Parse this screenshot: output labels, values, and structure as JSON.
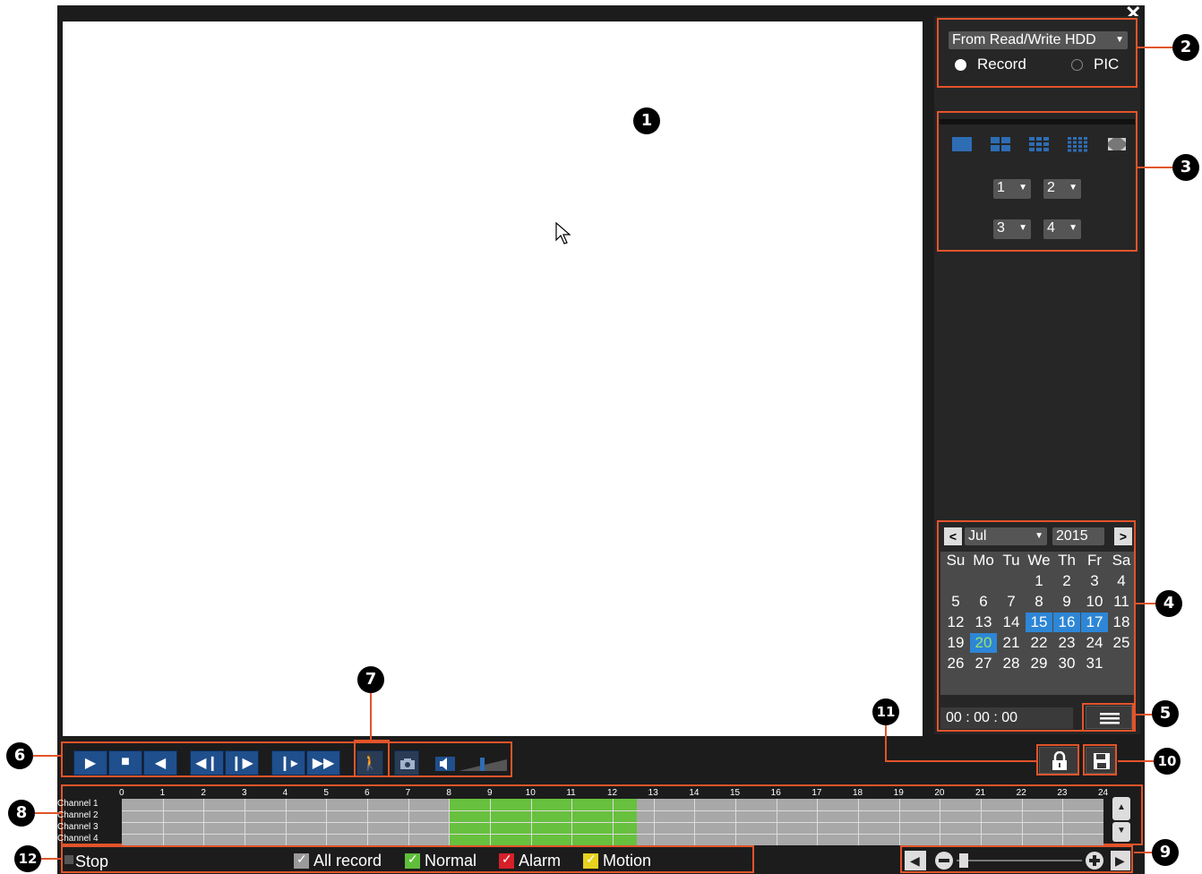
{
  "source": {
    "selected": "From Read/Write HDD",
    "options": [
      "Record",
      "PIC"
    ],
    "active": "Record"
  },
  "callouts": [
    "1",
    "2",
    "3",
    "4",
    "5",
    "6",
    "7",
    "8",
    "9",
    "10",
    "11",
    "12"
  ],
  "layout_icons": [
    "single-view-icon",
    "quad-view-icon",
    "nine-view-icon",
    "sixteen-view-icon",
    "fullscreen-icon"
  ],
  "channel_selects": [
    "1",
    "2",
    "3",
    "4"
  ],
  "calendar": {
    "month": "Jul",
    "year": "2015",
    "prev": "<",
    "next": ">",
    "weekdays": [
      "Su",
      "Mo",
      "Tu",
      "We",
      "Th",
      "Fr",
      "Sa"
    ],
    "days": [
      [
        "",
        "",
        "",
        "1",
        "2",
        "3",
        "4"
      ],
      [
        "5",
        "6",
        "7",
        "8",
        "9",
        "10",
        "11"
      ],
      [
        "12",
        "13",
        "14",
        "15",
        "16",
        "17",
        "18"
      ],
      [
        "19",
        "20",
        "21",
        "22",
        "23",
        "24",
        "25"
      ],
      [
        "26",
        "27",
        "28",
        "29",
        "30",
        "31",
        ""
      ]
    ],
    "highlighted": [
      "15",
      "16",
      "17"
    ],
    "today": "20"
  },
  "time": "00 : 00 : 00",
  "timeline": {
    "hours": [
      "0",
      "1",
      "2",
      "3",
      "4",
      "5",
      "6",
      "7",
      "8",
      "9",
      "10",
      "11",
      "12",
      "13",
      "14",
      "15",
      "16",
      "17",
      "18",
      "19",
      "20",
      "21",
      "22",
      "23",
      "24"
    ],
    "channels": [
      "Channel 1",
      "Channel 2",
      "Channel 3",
      "Channel 4"
    ],
    "recording": {
      "from_hour": 8,
      "to_hour": 12.6,
      "type": "Normal"
    }
  },
  "legend": {
    "stop": "Stop",
    "items": [
      {
        "label": "All record",
        "color": "#9a9a9a"
      },
      {
        "label": "Normal",
        "color": "#5fbf3a"
      },
      {
        "label": "Alarm",
        "color": "#d6202a"
      },
      {
        "label": "Motion",
        "color": "#e6d21f"
      }
    ]
  },
  "colors": {
    "accent": "#e2542a",
    "play_blue": "#1f4f8c",
    "record_green": "#67c03e"
  }
}
